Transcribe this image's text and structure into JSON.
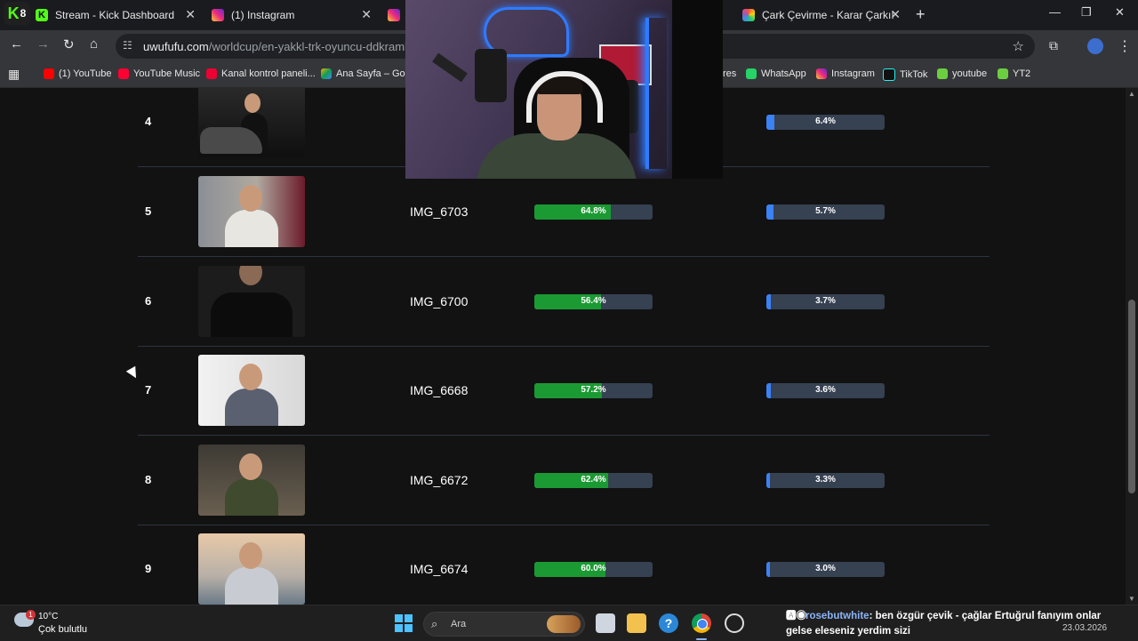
{
  "browser": {
    "profile_badge": {
      "letter": "K",
      "number": "8"
    },
    "tabs": [
      {
        "title": "Stream - Kick Dashboard",
        "favicon": "kick-icon"
      },
      {
        "title": "(1) Instagram",
        "favicon": "instagram-icon"
      },
      {
        "title": "",
        "favicon": "instagram-icon"
      },
      {
        "title": "Çark Çevirme - Karar Çarkı!",
        "favicon": "wheel-icon"
      }
    ],
    "url_domain": "uwufufu.com",
    "url_path": "/worldcup/en-yakkl-trk-oyuncu-ddkrambo",
    "bookmarks": [
      {
        "label": "(1) YouTube",
        "icon": "youtube-icon"
      },
      {
        "label": "YouTube Music",
        "icon": "youtube-music-icon"
      },
      {
        "label": "Kanal kontrol paneli...",
        "icon": "youtube-studio-icon"
      },
      {
        "label": "Ana Sayfa – Goog",
        "icon": "google-drive-icon"
      },
      {
        "label": "res",
        "icon": ""
      },
      {
        "label": "WhatsApp",
        "icon": "whatsapp-icon"
      },
      {
        "label": "Instagram",
        "icon": "instagram-icon"
      },
      {
        "label": "TikTok",
        "icon": "tiktok-icon"
      },
      {
        "label": "youtube",
        "icon": "sheets-icon"
      },
      {
        "label": "YT2",
        "icon": "sheets-icon"
      }
    ]
  },
  "rankings": [
    {
      "rank": "4",
      "name": "",
      "win_rate": "",
      "win_fraction": null,
      "champion_rate": "6.4%",
      "champion_fraction": 0.064
    },
    {
      "rank": "5",
      "name": "IMG_6703",
      "win_rate": "64.8%",
      "win_fraction": 0.648,
      "champion_rate": "5.7%",
      "champion_fraction": 0.057
    },
    {
      "rank": "6",
      "name": "IMG_6700",
      "win_rate": "56.4%",
      "win_fraction": 0.564,
      "champion_rate": "3.7%",
      "champion_fraction": 0.037
    },
    {
      "rank": "7",
      "name": "IMG_6668",
      "win_rate": "57.2%",
      "win_fraction": 0.572,
      "champion_rate": "3.6%",
      "champion_fraction": 0.036
    },
    {
      "rank": "8",
      "name": "IMG_6672",
      "win_rate": "62.4%",
      "win_fraction": 0.624,
      "champion_rate": "3.3%",
      "champion_fraction": 0.033
    },
    {
      "rank": "9",
      "name": "IMG_6674",
      "win_rate": "60.0%",
      "win_fraction": 0.6,
      "champion_rate": "3.0%",
      "champion_fraction": 0.03
    }
  ],
  "taskbar": {
    "weather_temp": "10°C",
    "weather_condition": "Çok bulutlu",
    "weather_badge": "1",
    "search_placeholder": "Ara",
    "date": "23.03.2026"
  },
  "chat": {
    "username": "rosebutwhite",
    "message": ": ben özgür çevik - çağlar Ertuğrul fanıyım onlar gelse eleseniz yerdim sizi"
  },
  "colors": {
    "win_bar": "#1b9a33",
    "champion_bar": "#3b82f6",
    "bar_track": "#364152"
  }
}
